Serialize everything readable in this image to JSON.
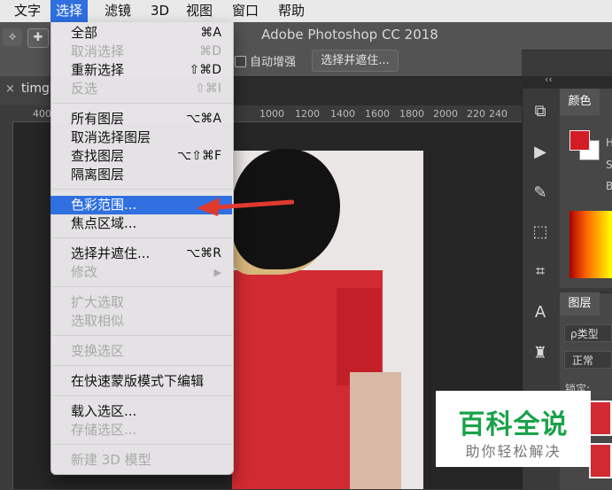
{
  "menubar": {
    "items": [
      "文字",
      "选择",
      "滤镜",
      "3D",
      "视图",
      "窗口",
      "帮助"
    ],
    "active": "选择"
  },
  "app": {
    "title": "Adobe Photoshop CC 2018"
  },
  "options_bar": {
    "auto_enhance": "自动增强",
    "select_and_mask_button": "选择并遮住..."
  },
  "document_tab": {
    "name": "timg.",
    "close": "×"
  },
  "ruler": {
    "ticks": [
      "400",
      "1000",
      "1200",
      "1400",
      "1600",
      "1800",
      "2000",
      "220",
      "240"
    ]
  },
  "select_menu": {
    "items": [
      {
        "label": "全部",
        "shortcut": "⌘A",
        "disabled": false
      },
      {
        "label": "取消选择",
        "shortcut": "⌘D",
        "disabled": true
      },
      {
        "label": "重新选择",
        "shortcut": "⇧⌘D",
        "disabled": false
      },
      {
        "label": "反选",
        "shortcut": "⇧⌘I",
        "disabled": true
      },
      {
        "label": "所有图层",
        "shortcut": "⌥⌘A",
        "disabled": false
      },
      {
        "label": "取消选择图层",
        "shortcut": "",
        "disabled": false
      },
      {
        "label": "查找图层",
        "shortcut": "⌥⇧⌘F",
        "disabled": false
      },
      {
        "label": "隔离图层",
        "shortcut": "",
        "disabled": false
      },
      {
        "label": "色彩范围...",
        "shortcut": "",
        "disabled": false,
        "highlighted": true
      },
      {
        "label": "焦点区域...",
        "shortcut": "",
        "disabled": false
      },
      {
        "label": "选择并遮住...",
        "shortcut": "⌥⌘R",
        "disabled": false
      },
      {
        "label": "修改",
        "shortcut": "",
        "disabled": true,
        "submenu": true
      },
      {
        "label": "扩大选取",
        "shortcut": "",
        "disabled": true
      },
      {
        "label": "选取相似",
        "shortcut": "",
        "disabled": true
      },
      {
        "label": "变换选区",
        "shortcut": "",
        "disabled": true
      },
      {
        "label": "在快速蒙版模式下编辑",
        "shortcut": "",
        "disabled": false
      },
      {
        "label": "载入选区...",
        "shortcut": "",
        "disabled": false
      },
      {
        "label": "存储选区...",
        "shortcut": "",
        "disabled": true
      },
      {
        "label": "新建 3D 模型",
        "shortcut": "",
        "disabled": true
      }
    ]
  },
  "color_panel": {
    "tab": "颜色",
    "channels": [
      "H",
      "S",
      "B"
    ],
    "foreground": "#d21c26",
    "background": "#ffffff"
  },
  "layers_panel": {
    "tab": "图层",
    "kind": "ρ类型",
    "blend": "正常",
    "lock": "锁定:"
  },
  "right_toolbar_icons": [
    "puzzle-icon",
    "play-icon",
    "brush-settings-icon",
    "3d-cube-icon",
    "crop-icon",
    "type-icon",
    "stamp-icon"
  ],
  "watermark": {
    "title": "百科全说",
    "subtitle": "助你轻松解决"
  },
  "colors": {
    "menu_highlight": "#2f6fe0",
    "arrow": "#e03a2f",
    "watermark_green": "#19a24a"
  }
}
